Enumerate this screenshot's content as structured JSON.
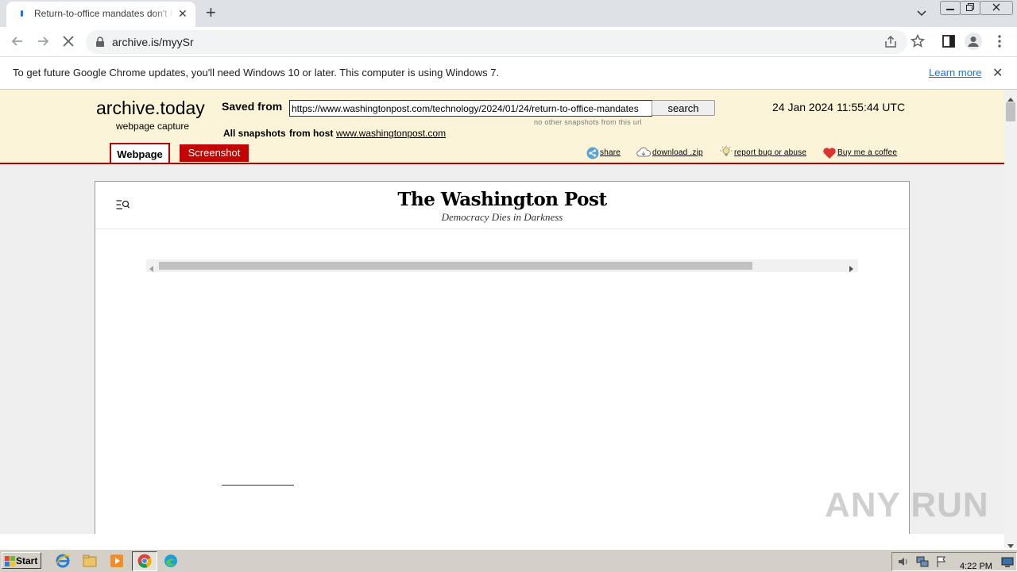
{
  "browser": {
    "tab_title": "Return-to-office mandates don't help",
    "address": "archive.is/myySr",
    "infobar_message": "To get future Google Chrome updates, you'll need Windows 10 or later. This computer is using Windows 7.",
    "infobar_link": "Learn more"
  },
  "archive": {
    "brand": "archive.today",
    "brand_subtitle": "webpage capture",
    "saved_from_label": "Saved from",
    "url_value": "https://www.washingtonpost.com/technology/2024/01/24/return-to-office-mandates",
    "search_label": "search",
    "no_snapshots": "no other snapshots from this url",
    "capture_date": "24 Jan 2024 11:55:44 UTC",
    "all_snapshots_label": "All snapshots",
    "from_host_label": "from host",
    "host": "www.washingtonpost.com",
    "tabs": [
      "Webpage",
      "Screenshot"
    ],
    "links": {
      "share": "share",
      "download": "download .zip",
      "report": "report bug or abuse",
      "coffee": "Buy me a coffee"
    }
  },
  "page": {
    "logo": "The Washington Post",
    "tagline": "Democracy Dies in Darkness"
  },
  "watermark": "ANY RUN",
  "taskbar": {
    "start": "Start",
    "clock": "4:22 PM"
  }
}
